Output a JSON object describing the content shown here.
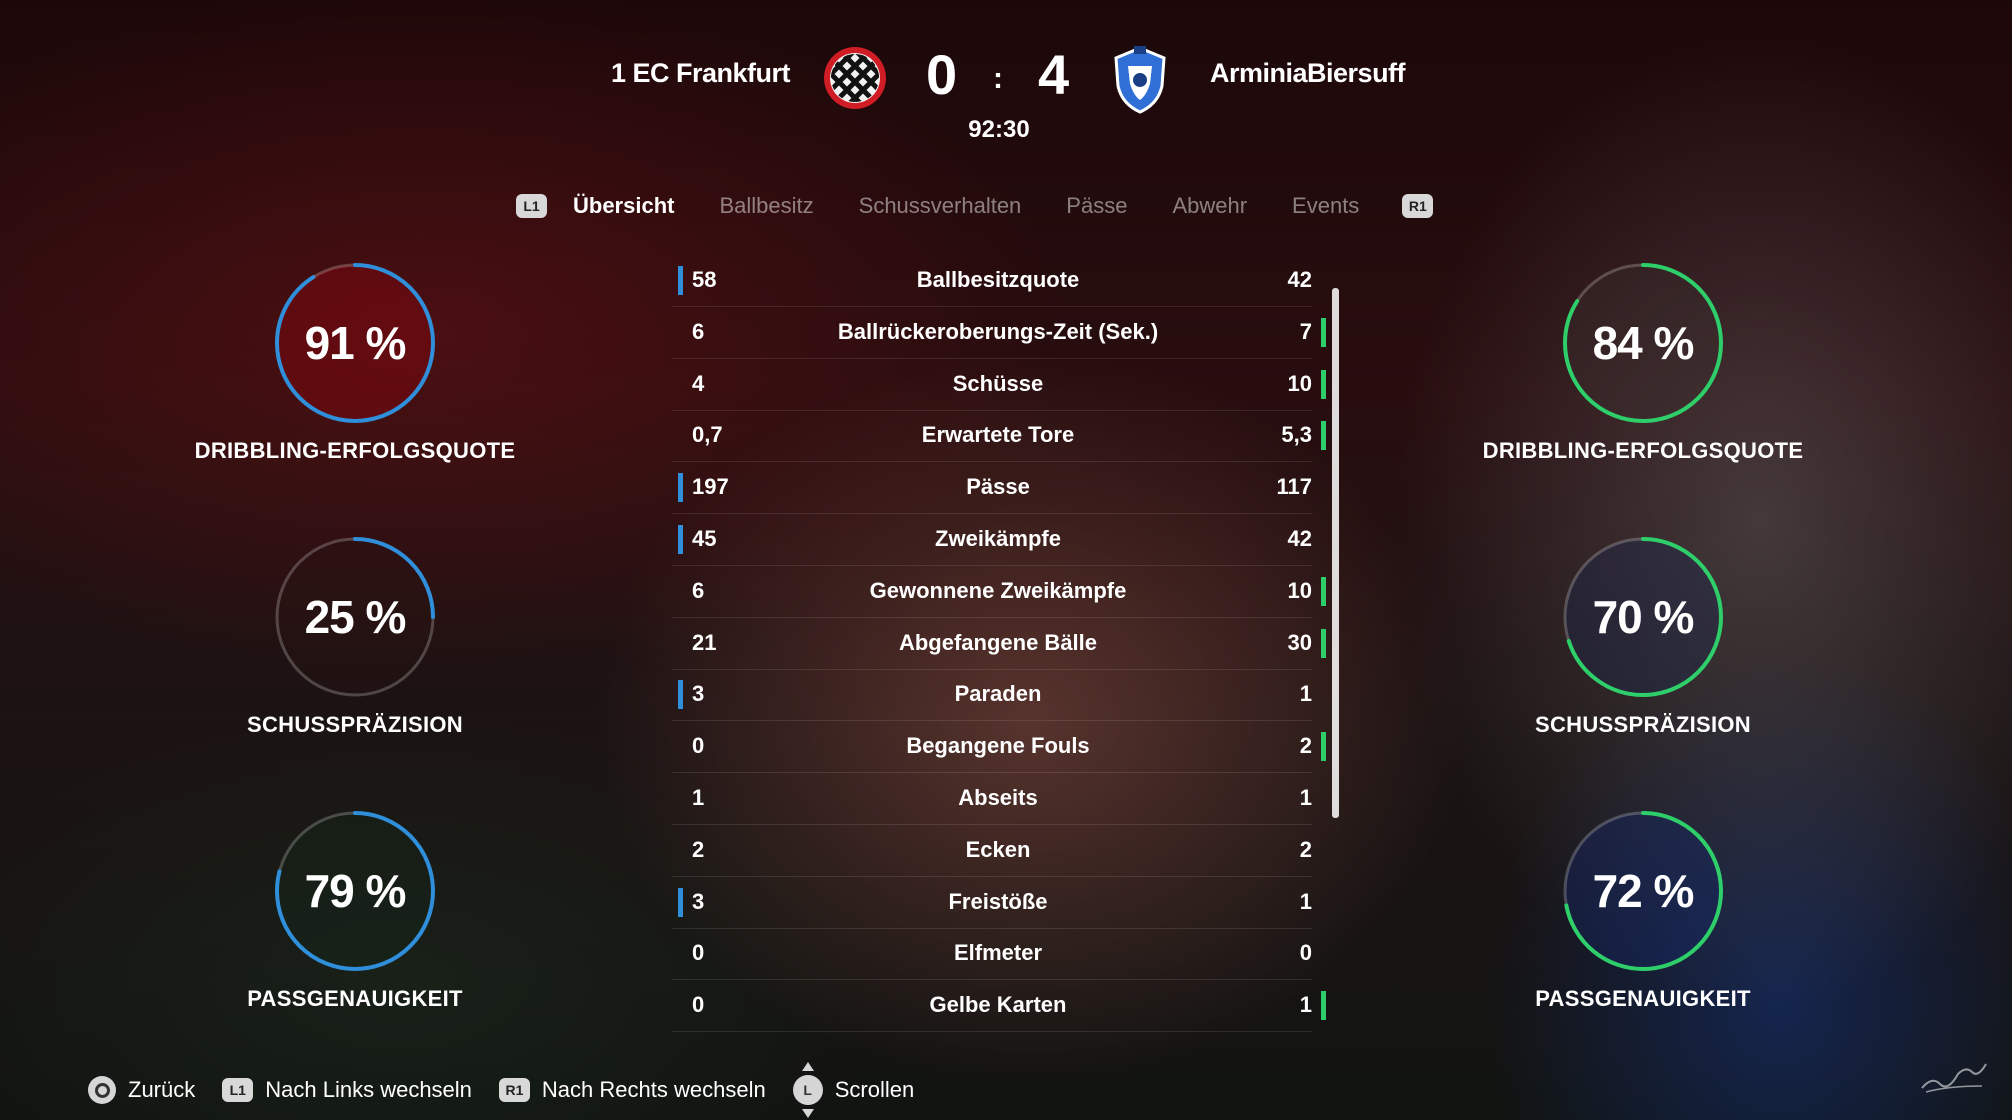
{
  "match": {
    "home_team": "1 EC Frankfurt",
    "away_team": "ArminiaBiersuff",
    "home_score": "0",
    "away_score": "4",
    "separator": ":",
    "clock": "92:30",
    "home_color": "#d01c24",
    "away_color": "#2f6fd6"
  },
  "tabs": {
    "left_button": "L1",
    "right_button": "R1",
    "items": [
      {
        "label": "Übersicht",
        "active": true
      },
      {
        "label": "Ballbesitz",
        "active": false
      },
      {
        "label": "Schussverhalten",
        "active": false
      },
      {
        "label": "Pässe",
        "active": false
      },
      {
        "label": "Abwehr",
        "active": false
      },
      {
        "label": "Events",
        "active": false
      }
    ]
  },
  "gauges": {
    "home": [
      {
        "value_text": "91 %",
        "fraction": 0.91,
        "label": "DRIBBLING-ERFOLGSQUOTE"
      },
      {
        "value_text": "25 %",
        "fraction": 0.25,
        "label": "SCHUSSPRÄZISION"
      },
      {
        "value_text": "79 %",
        "fraction": 0.79,
        "label": "PASSGENAUIGKEIT"
      }
    ],
    "away": [
      {
        "value_text": "84 %",
        "fraction": 0.84,
        "label": "DRIBBLING-ERFOLGSQUOTE"
      },
      {
        "value_text": "70 %",
        "fraction": 0.7,
        "label": "SCHUSSPRÄZISION"
      },
      {
        "value_text": "72 %",
        "fraction": 0.72,
        "label": "PASSGENAUIGKEIT"
      }
    ],
    "home_color": "#2f8fdb",
    "away_color": "#2ecf6a"
  },
  "stats": [
    {
      "name": "Ballbesitzquote",
      "home": "58",
      "away": "42",
      "leader": "home"
    },
    {
      "name": "Ballrückeroberungs-Zeit (Sek.)",
      "home": "6",
      "away": "7",
      "leader": "away"
    },
    {
      "name": "Schüsse",
      "home": "4",
      "away": "10",
      "leader": "away"
    },
    {
      "name": "Erwartete Tore",
      "home": "0,7",
      "away": "5,3",
      "leader": "away"
    },
    {
      "name": "Pässe",
      "home": "197",
      "away": "117",
      "leader": "home"
    },
    {
      "name": "Zweikämpfe",
      "home": "45",
      "away": "42",
      "leader": "home"
    },
    {
      "name": "Gewonnene Zweikämpfe",
      "home": "6",
      "away": "10",
      "leader": "away"
    },
    {
      "name": "Abgefangene Bälle",
      "home": "21",
      "away": "30",
      "leader": "away"
    },
    {
      "name": "Paraden",
      "home": "3",
      "away": "1",
      "leader": "home"
    },
    {
      "name": "Begangene Fouls",
      "home": "0",
      "away": "2",
      "leader": "away"
    },
    {
      "name": "Abseits",
      "home": "1",
      "away": "1",
      "leader": "none"
    },
    {
      "name": "Ecken",
      "home": "2",
      "away": "2",
      "leader": "none"
    },
    {
      "name": "Freistöße",
      "home": "3",
      "away": "1",
      "leader": "home"
    },
    {
      "name": "Elfmeter",
      "home": "0",
      "away": "0",
      "leader": "none"
    },
    {
      "name": "Gelbe Karten",
      "home": "0",
      "away": "1",
      "leader": "away"
    }
  ],
  "footer": {
    "back_label": "Zurück",
    "left_button": "L1",
    "left_label": "Nach Links wechseln",
    "right_button": "R1",
    "right_label": "Nach Rechts wechseln",
    "stick_button": "L",
    "scroll_label": "Scrollen"
  }
}
